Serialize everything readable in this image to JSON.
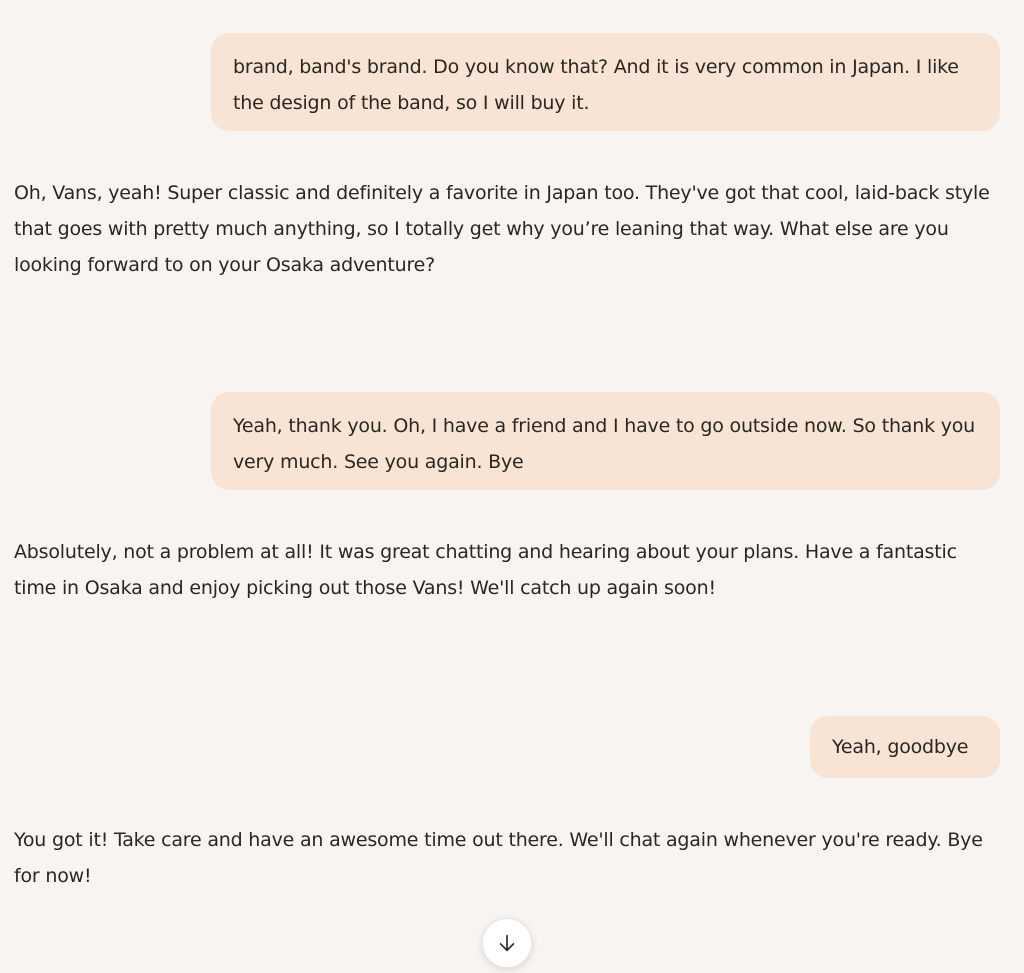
{
  "messages": {
    "user_1": "brand, band's brand. Do you know that? And it is very common in Japan. I like the design of the band, so I will buy it.",
    "assistant_1": "Oh, Vans, yeah! Super classic and definitely a favorite in Japan too. They've got that cool, laid-back style that goes with pretty much anything, so I totally get why you’re leaning that way. What else are you looking forward to on your Osaka adventure?",
    "user_2": "Yeah, thank you. Oh, I have a friend and I have to go outside now. So thank you very much. See you again. Bye",
    "assistant_2": "Absolutely, not a problem at all! It was great chatting and hearing about your plans. Have a fantastic time in Osaka and enjoy picking out those Vans! We'll catch up again soon!",
    "user_3": "Yeah, goodbye",
    "assistant_3": "You got it! Take care and have an awesome time out there. We'll chat again whenever you're ready. Bye for now!"
  },
  "scroll_button": {
    "icon": "arrow-down-icon"
  },
  "colors": {
    "background": "#f8f4f1",
    "user_bubble": "#f7e4d4",
    "text": "#2b2621"
  }
}
